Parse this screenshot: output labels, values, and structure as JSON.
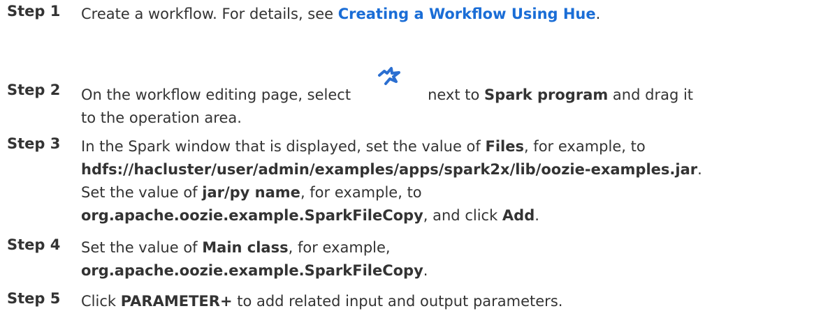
{
  "steps": [
    {
      "label": "Step 1",
      "t1": "Create a workflow. For details, see ",
      "link": "Creating a Workflow Using Hue",
      "t2": "."
    },
    {
      "label": "Step 2",
      "t1": "On the workflow editing page, select",
      "icon": "spark-program-icon",
      "t2": "next to ",
      "b1": "Spark program",
      "t3": " and drag it",
      "line2": "to the operation area."
    },
    {
      "label": "Step 3",
      "t1": "In the Spark window that is displayed, set the value of ",
      "b1": "Files",
      "t2": ", for example, to",
      "b2": "hdfs://hacluster/user/admin/examples/apps/spark2x/lib/oozie-examples.jar",
      "t3": ".",
      "t4": "Set the value of ",
      "b3": "jar/py name",
      "t5": ", for example, to",
      "b4": "org.apache.oozie.example.SparkFileCopy",
      "t6": ", and click ",
      "b5": "Add",
      "t7": "."
    },
    {
      "label": "Step 4",
      "t1": "Set the value of ",
      "b1": "Main class",
      "t2": ", for example,",
      "b2": "org.apache.oozie.example.SparkFileCopy",
      "t3": "."
    },
    {
      "label": "Step 5",
      "t1": "Click ",
      "b1": "PARAMETER+",
      "t2": " to add related input and output parameters."
    }
  ],
  "colors": {
    "text": "#333333",
    "link": "#1a6dd6",
    "icon": "#2b6fd1"
  }
}
